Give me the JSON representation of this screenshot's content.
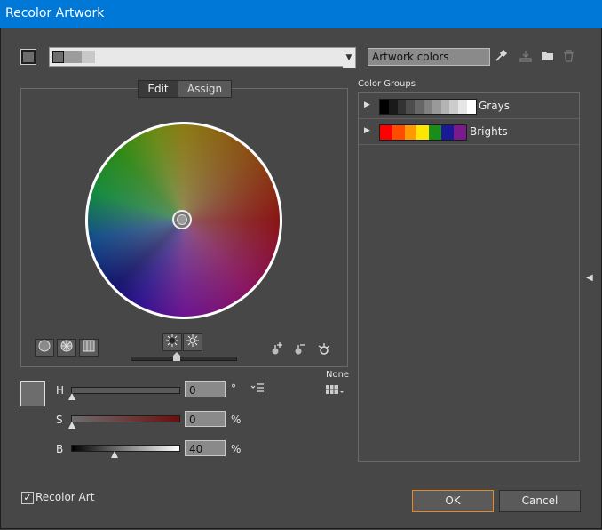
{
  "window": {
    "title": "Recolor Artwork"
  },
  "toolbar": {
    "harmony_name": "Artwork colors"
  },
  "tabs": {
    "edit": "Edit",
    "assign": "Assign"
  },
  "hsb": {
    "h_label": "H",
    "h_value": "0",
    "h_unit": "°",
    "s_label": "S",
    "s_value": "0",
    "s_unit": "%",
    "b_label": "B",
    "b_value": "40",
    "b_unit": "%"
  },
  "limit_label": "None",
  "color_groups": {
    "label": "Color Groups",
    "groups": [
      {
        "name": "Grays",
        "swatches": [
          "#000000",
          "#1a1a1a",
          "#333333",
          "#4d4d4d",
          "#666666",
          "#808080",
          "#999999",
          "#b3b3b3",
          "#cccccc",
          "#e6e6e6",
          "#ffffff"
        ]
      },
      {
        "name": "Brights",
        "swatches": [
          "#ff0000",
          "#ff4d00",
          "#ff9900",
          "#ffe600",
          "#1a8c1a",
          "#1a1a99",
          "#7a1a8c"
        ]
      }
    ]
  },
  "footer": {
    "recolor_label": "Recolor Art",
    "recolor_checked": true,
    "ok_label": "OK",
    "cancel_label": "Cancel"
  },
  "colors": {
    "title_bar": "#0078d7",
    "ok_focus": "#e8872a",
    "current_color": "#6d6d6d"
  }
}
